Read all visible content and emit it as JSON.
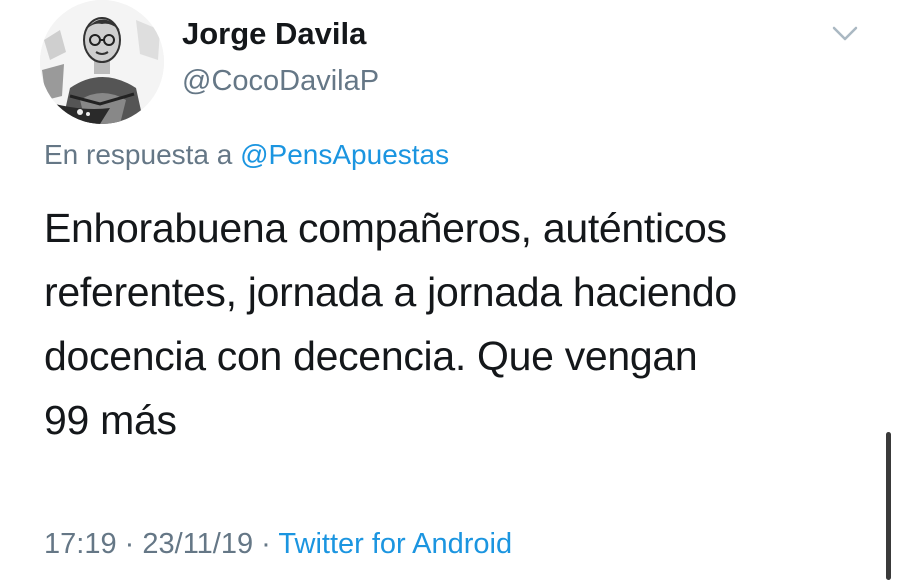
{
  "author": {
    "name": "Jorge Davila",
    "handle": "@CocoDavilaP",
    "avatar_icon": "profile-photo-icon"
  },
  "reply": {
    "prefix": "En respuesta a",
    "mention": "@PensApuestas"
  },
  "tweet": {
    "lines": [
      "Enhorabuena compañeros, auténticos",
      "referentes, jornada a jornada haciendo",
      "docencia con decencia. Que vengan",
      "99 más"
    ]
  },
  "meta": {
    "time": "17:19",
    "separator": "·",
    "date": "23/11/19",
    "source": "Twitter for Android"
  },
  "icons": {
    "menu": "chevron-down-icon"
  },
  "colors": {
    "text": "#14171a",
    "secondary": "#657786",
    "link": "#1b95e0"
  }
}
